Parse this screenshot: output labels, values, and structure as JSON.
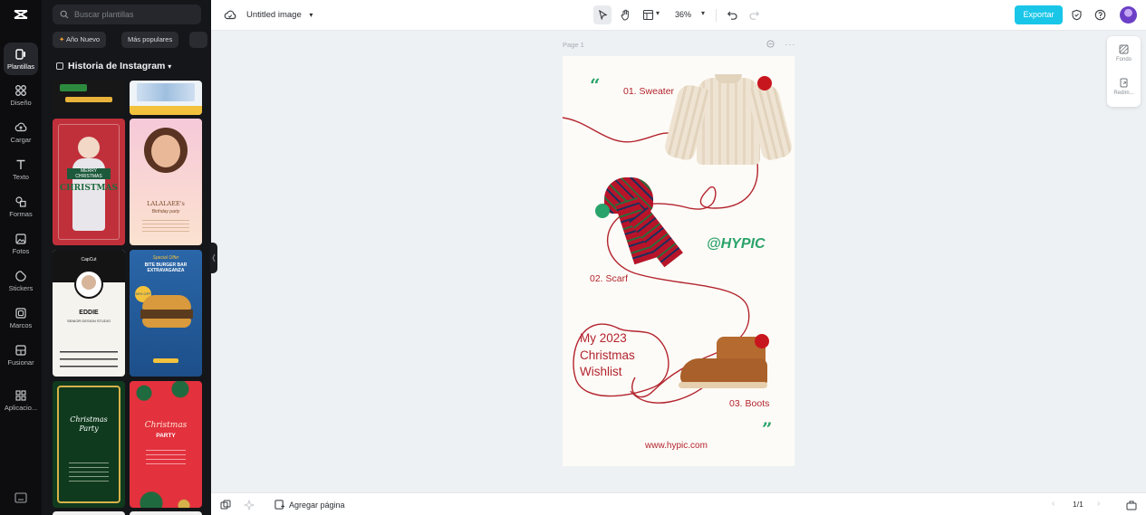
{
  "sidebar": {
    "items": [
      {
        "label": "Plantillas",
        "icon": "templates-icon"
      },
      {
        "label": "Diseño",
        "icon": "design-icon"
      },
      {
        "label": "Cargar",
        "icon": "upload-icon"
      },
      {
        "label": "Texto",
        "icon": "text-icon"
      },
      {
        "label": "Formas",
        "icon": "shapes-icon"
      },
      {
        "label": "Fotos",
        "icon": "photos-icon"
      },
      {
        "label": "Stickers",
        "icon": "stickers-icon"
      },
      {
        "label": "Marcos",
        "icon": "frames-icon"
      },
      {
        "label": "Fusionar",
        "icon": "merge-icon"
      },
      {
        "label": "Aplicacio...",
        "icon": "apps-icon"
      }
    ]
  },
  "templates": {
    "search_placeholder": "Buscar plantillas",
    "chips": [
      "Año Nuevo",
      "Más populares"
    ],
    "section_title": "Historia de Instagram",
    "cards": {
      "christmas_red": "CHRISTMAS",
      "christmas_red_sub": "MERRY CHRISTMAS",
      "portrait_name": "LALALAEE's",
      "portrait_sub": "Birthday party",
      "capcut_brand": "CapCut",
      "profile_name": "EDDIE",
      "profile_sub": "SENIOR DESIGN STUDIO",
      "burger_top": "Special Offer",
      "burger_title": "BITE BURGER BAR EXTRAVAGANZA",
      "burger_badge": "50% OFF",
      "party_title": "Christmas Party",
      "party2_title": "Christmas",
      "party2_sub": "PARTY"
    }
  },
  "topbar": {
    "doc_title": "Untitled image",
    "zoom": "36%",
    "export_label": "Exportar"
  },
  "canvas": {
    "page_label": "Page 1",
    "design": {
      "item1": "01. Sweater",
      "item2": "02. Scarf",
      "item3": "03. Boots",
      "handle": "@HYPIC",
      "wishlist_line1": "My 2023",
      "wishlist_line2": "Christmas",
      "wishlist_line3": "Wishlist",
      "website": "www.hypic.com",
      "open_quote": "“",
      "close_quote": "”"
    }
  },
  "right_panel": {
    "items": [
      {
        "label": "Fondo",
        "icon": "background-icon"
      },
      {
        "label": "Redim...",
        "icon": "resize-icon"
      }
    ]
  },
  "bottombar": {
    "add_page": "Agregar página",
    "pager": "1/1"
  },
  "colors": {
    "accent": "#19c6e8",
    "design_red": "#b3242e",
    "design_green": "#2aa36a"
  }
}
